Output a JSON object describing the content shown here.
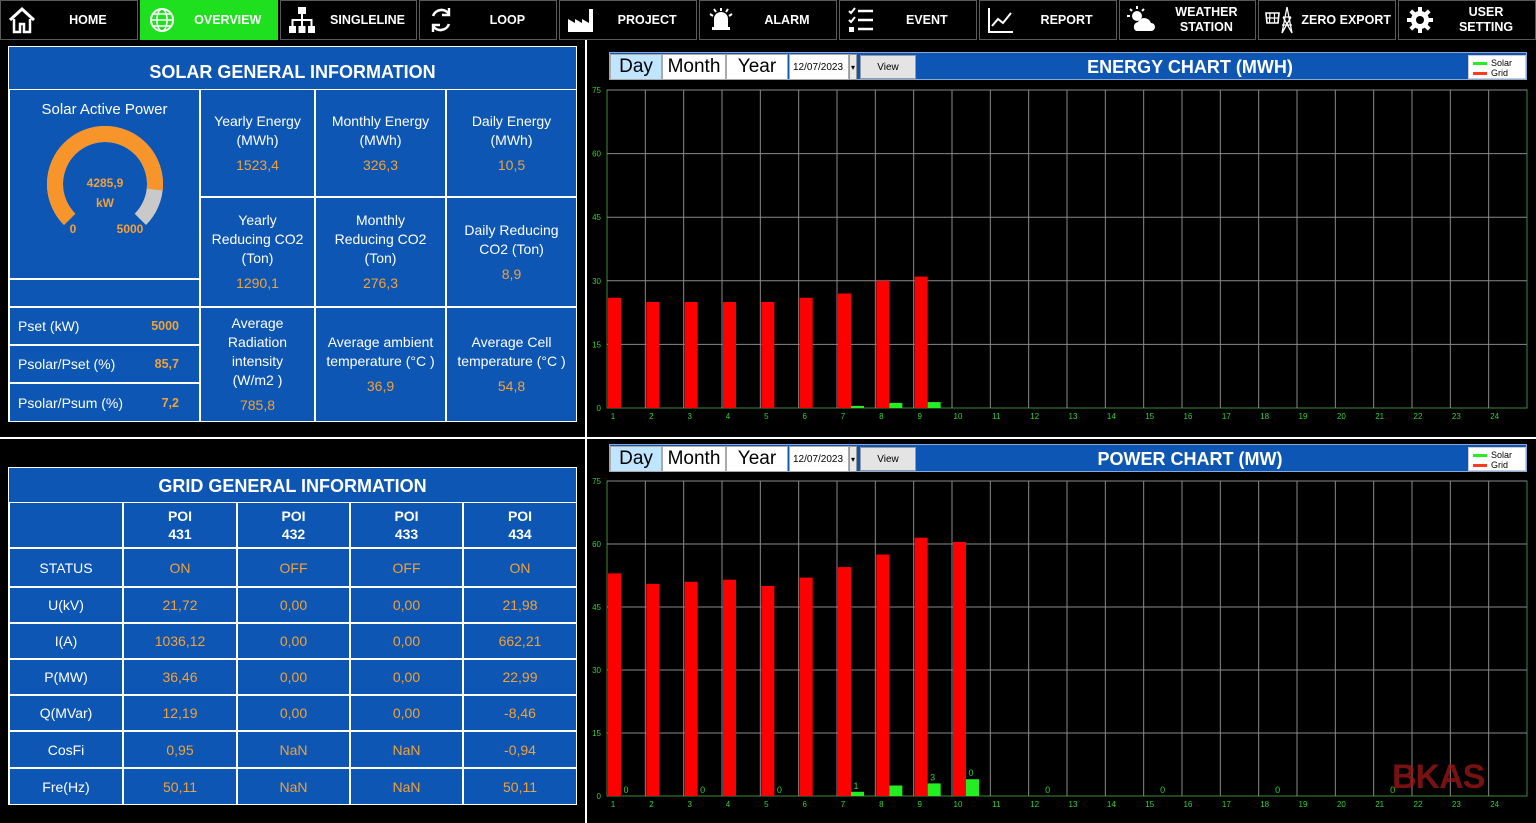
{
  "nav": [
    {
      "label": "HOME",
      "icon": "home-icon"
    },
    {
      "label": "OVERVIEW",
      "icon": "globe-icon",
      "active": true
    },
    {
      "label": "SINGLELINE",
      "icon": "network-icon"
    },
    {
      "label": "LOOP",
      "icon": "loop-icon"
    },
    {
      "label": "PROJECT",
      "icon": "factory-icon"
    },
    {
      "label": "ALARM",
      "icon": "alarm-bell-icon"
    },
    {
      "label": "EVENT",
      "icon": "checklist-icon"
    },
    {
      "label": "REPORT",
      "icon": "line-chart-icon"
    },
    {
      "label": "WEATHER STATION",
      "icon": "weather-icon"
    },
    {
      "label": "ZERO EXPORT",
      "icon": "solar-tower-icon"
    },
    {
      "label": "USER SETTING",
      "icon": "gear-icon"
    }
  ],
  "solar": {
    "title": "SOLAR GENERAL INFORMATION",
    "active_power": {
      "label": "Solar Active Power",
      "value": "4285,9",
      "unit": "kW",
      "min": "0",
      "max": "5000",
      "fraction": 0.857
    },
    "cells": [
      {
        "label": "Yearly Energy (MWh)",
        "value": "1523,4"
      },
      {
        "label": "Monthly Energy (MWh)",
        "value": "326,3"
      },
      {
        "label": "Daily Energy (MWh)",
        "value": "10,5"
      },
      {
        "label": "Yearly Reducing CO2 (Ton)",
        "value": "1290,1"
      },
      {
        "label": "Monthly Reducing CO2 (Ton)",
        "value": "276,3"
      },
      {
        "label": "Daily Reducing CO2 (Ton)",
        "value": "8,9"
      },
      {
        "label": "Average Radiation intensity (W/m2 )",
        "value": "785,8"
      },
      {
        "label": "Average ambient temperature (°C )",
        "value": "36,9"
      },
      {
        "label": "Average Cell temperature (°C )",
        "value": "54,8"
      }
    ],
    "rows": [
      {
        "label": "Pset (kW)",
        "value": "5000"
      },
      {
        "label": "Psolar/Pset (%)",
        "value": "85,7"
      },
      {
        "label": "Psolar/Psum (%)",
        "value": "7,2"
      }
    ]
  },
  "grid": {
    "title": "GRID GENERAL INFORMATION",
    "columns": [
      {
        "name": "POI",
        "num": "431"
      },
      {
        "name": "POI",
        "num": "432"
      },
      {
        "name": "POI",
        "num": "433"
      },
      {
        "name": "POI",
        "num": "434"
      }
    ],
    "rows": [
      {
        "label": "STATUS",
        "values": [
          "ON",
          "OFF",
          "OFF",
          "ON"
        ]
      },
      {
        "label": "U(kV)",
        "values": [
          "21,72",
          "0,00",
          "0,00",
          "21,98"
        ]
      },
      {
        "label": "I(A)",
        "values": [
          "1036,12",
          "0,00",
          "0,00",
          "662,21"
        ]
      },
      {
        "label": "P(MW)",
        "values": [
          "36,46",
          "0,00",
          "0,00",
          "22,99"
        ]
      },
      {
        "label": "Q(MVar)",
        "values": [
          "12,19",
          "0,00",
          "0,00",
          "-8,46"
        ]
      },
      {
        "label": "CosFi",
        "values": [
          "0,95",
          "NaN",
          "NaN",
          "-0,94"
        ]
      },
      {
        "label": "Fre(Hz)",
        "values": [
          "50,11",
          "NaN",
          "NaN",
          "50,11"
        ]
      }
    ]
  },
  "energy_chart": {
    "tabs": {
      "day": "Day",
      "month": "Month",
      "year": "Year"
    },
    "date": "12/07/2023",
    "view_label": "View",
    "title": "ENERGY CHART (MWH)",
    "legend": {
      "solar": "Solar",
      "grid": "Grid"
    }
  },
  "power_chart": {
    "tabs": {
      "day": "Day",
      "month": "Month",
      "year": "Year"
    },
    "date": "12/07/2023",
    "view_label": "View",
    "title": "POWER CHART (MW)",
    "legend": {
      "solar": "Solar",
      "grid": "Grid"
    }
  },
  "colors": {
    "panel": "#0d56b3",
    "value": "#f2a238",
    "solar": "#22ee22",
    "grid": "#ff0000",
    "nav_active": "#1ee01e"
  },
  "watermark": "BKAS",
  "chart_data": [
    {
      "type": "bar",
      "title": "ENERGY CHART (MWH)",
      "categories": [
        "1",
        "2",
        "3",
        "4",
        "5",
        "6",
        "7",
        "8",
        "9",
        "10",
        "11",
        "12",
        "13",
        "14",
        "15",
        "16",
        "17",
        "18",
        "19",
        "20",
        "21",
        "22",
        "23",
        "24"
      ],
      "ylim": [
        0,
        75
      ],
      "yticks": [
        0,
        15,
        30,
        45,
        60,
        75
      ],
      "grid": true,
      "legend": "top-right",
      "series": [
        {
          "name": "Grid",
          "color": "#ff0000",
          "values": [
            26,
            25,
            25,
            25,
            25,
            26,
            27,
            30,
            31
          ]
        },
        {
          "name": "Solar",
          "color": "#22ee22",
          "values": [
            0,
            0,
            0,
            0,
            0,
            0,
            0.5,
            1.2,
            1.4
          ]
        }
      ],
      "point_labels": []
    },
    {
      "type": "bar",
      "title": "POWER CHART (MW)",
      "categories": [
        "1",
        "2",
        "3",
        "4",
        "5",
        "6",
        "7",
        "8",
        "9",
        "10",
        "11",
        "12",
        "13",
        "14",
        "15",
        "16",
        "17",
        "18",
        "19",
        "20",
        "21",
        "22",
        "23",
        "24"
      ],
      "ylim": [
        0,
        75
      ],
      "yticks": [
        0,
        15,
        30,
        45,
        60,
        75
      ],
      "grid": true,
      "legend": "top-right",
      "series": [
        {
          "name": "Grid",
          "color": "#ff0000",
          "values": [
            53,
            50.5,
            51,
            51.5,
            50,
            52,
            54.5,
            57.5,
            61.5,
            60.5
          ]
        },
        {
          "name": "Solar",
          "color": "#22ee22",
          "values": [
            0,
            0,
            0,
            0,
            0,
            0,
            1,
            2.5,
            3,
            4
          ]
        }
      ],
      "point_labels": [
        {
          "x": "1",
          "text": "0"
        },
        {
          "x": "3",
          "text": "0"
        },
        {
          "x": "5",
          "text": "0"
        },
        {
          "x": "7",
          "text": "1"
        },
        {
          "x": "9",
          "text": "3"
        },
        {
          "x": "10",
          "text": "0"
        },
        {
          "x": "12",
          "text": "0"
        },
        {
          "x": "15",
          "text": "0"
        },
        {
          "x": "18",
          "text": "0"
        },
        {
          "x": "21",
          "text": "0"
        }
      ]
    }
  ]
}
